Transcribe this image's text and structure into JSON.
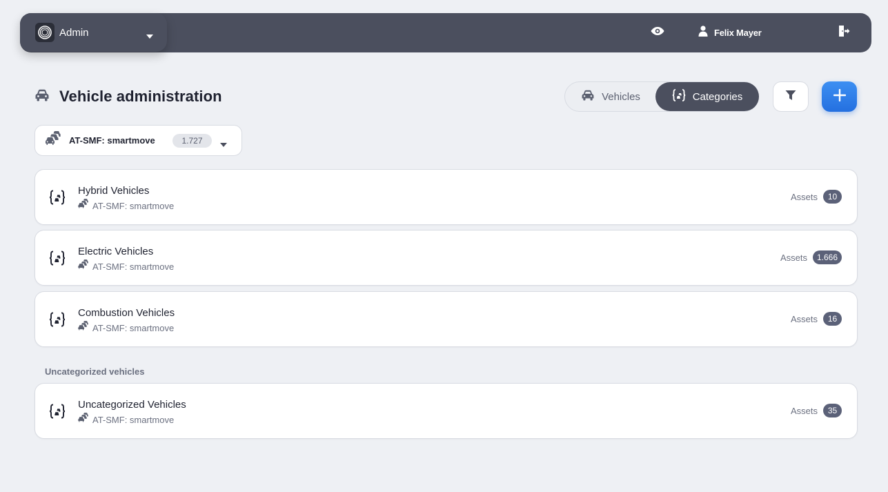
{
  "topbar": {
    "role": "Admin",
    "user_name": "Felix Mayer",
    "icons": {
      "logo": "app-logo-icon",
      "eye": "eye-icon",
      "user": "user-icon",
      "logout": "logout-door-icon"
    }
  },
  "header": {
    "title": "Vehicle administration",
    "tabs": [
      {
        "label": "Vehicles",
        "active": false
      },
      {
        "label": "Categories",
        "active": true
      }
    ]
  },
  "fleet_selector": {
    "name": "AT-SMF: smartmove",
    "count": "1.727"
  },
  "categories": [
    {
      "title": "Hybrid Vehicles",
      "fleet": "AT-SMF: smartmove",
      "assets_label": "Assets",
      "assets": "10"
    },
    {
      "title": "Electric Vehicles",
      "fleet": "AT-SMF: smartmove",
      "assets_label": "Assets",
      "assets": "1.666"
    },
    {
      "title": "Combustion Vehicles",
      "fleet": "AT-SMF: smartmove",
      "assets_label": "Assets",
      "assets": "16"
    }
  ],
  "uncategorized": {
    "section_label": "Uncategorized vehicles",
    "title": "Uncategorized Vehicles",
    "fleet": "AT-SMF: smartmove",
    "assets_label": "Assets",
    "assets": "35"
  },
  "colors": {
    "background": "#eef0f4",
    "topbar": "#4b4f5e",
    "accent": "#2f80ed",
    "badge": "#5b6178"
  }
}
